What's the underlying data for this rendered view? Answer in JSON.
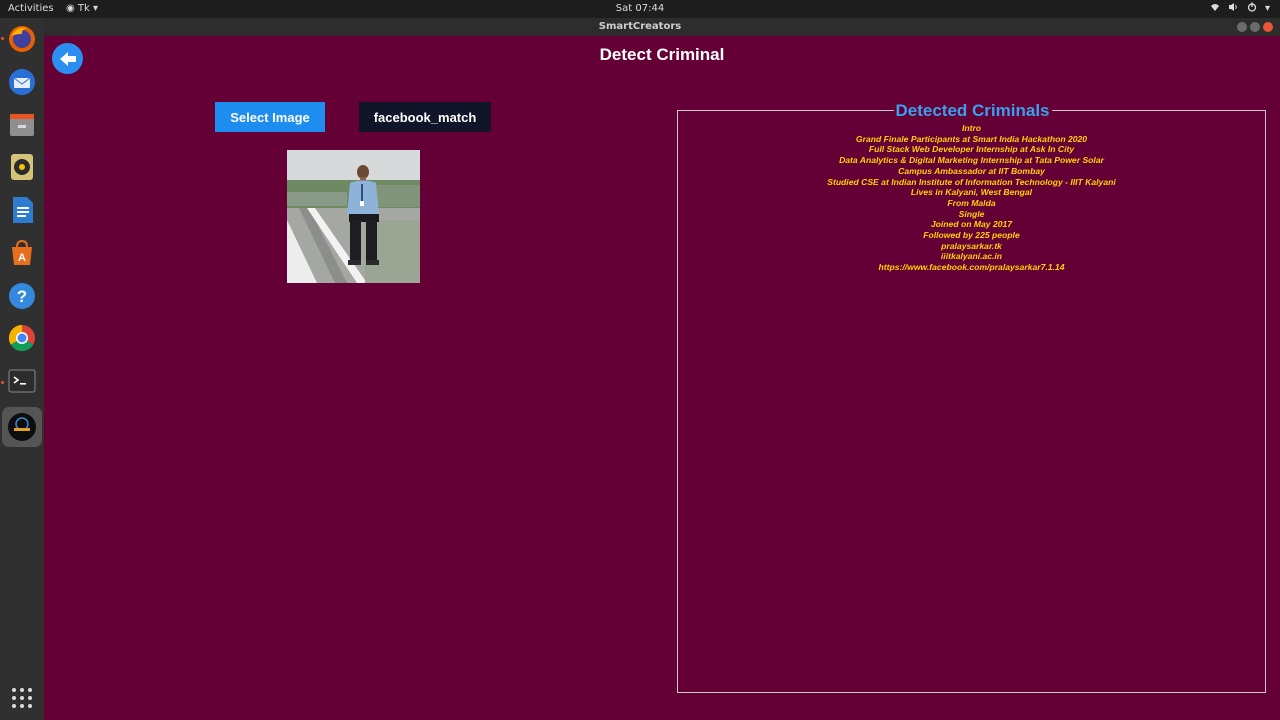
{
  "topbar": {
    "activities": "Activities",
    "app_menu": "Tk",
    "clock": "Sat 07:44"
  },
  "window": {
    "title": "SmartCreators"
  },
  "dock": {
    "items": [
      "firefox-icon",
      "thunderbird-icon",
      "files-icon",
      "rhythmbox-icon",
      "writer-icon",
      "software-icon",
      "help-icon",
      "chrome-icon",
      "terminal-icon",
      "smartcreators-icon",
      "app-grid-icon"
    ]
  },
  "main": {
    "page_title": "Detect Criminal",
    "select_button": "Select Image",
    "facebook_button": "facebook_match"
  },
  "panel": {
    "title": "Detected Criminals",
    "lines": [
      "Intro",
      "Grand Finale Participants at Smart India Hackathon 2020",
      "Full Stack Web Developer Internship at Ask In City",
      "Data Analytics & Digital Marketing Internship at Tata Power Solar",
      "Campus Ambassador at IIT Bombay",
      "Studied CSE at Indian Institute of Information Technology - IIIT Kalyani",
      "Lives in Kalyani, West Bengal",
      "From Malda",
      "Single",
      "Joined on May 2017",
      "Followed by 225 people",
      "pralaysarkar.tk",
      "iiitkalyani.ac.in",
      "https://www.facebook.com/pralaysarkar7.1.14"
    ]
  },
  "colors": {
    "background": "#650036",
    "accent_blue": "#1e8df0",
    "dark_button": "#11152a",
    "info_text": "#ffd200",
    "panel_title": "#3aa0ee"
  }
}
